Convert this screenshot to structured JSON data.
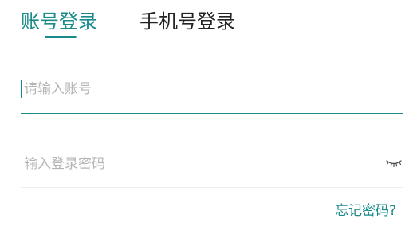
{
  "tabs": {
    "account_login": "账号登录",
    "phone_login": "手机号登录",
    "active_color": "#1a8a8a",
    "inactive_color": "#222222"
  },
  "account_field": {
    "value": "",
    "placeholder": "请输入账号"
  },
  "password_field": {
    "value": "",
    "placeholder": "输入登录密码",
    "toggle_icon": "eye-closed-icon"
  },
  "forgot_password": "忘记密码?",
  "colors": {
    "accent": "#1a8a8a",
    "placeholder": "#b5b5b5",
    "divider": "#eeeeee"
  }
}
